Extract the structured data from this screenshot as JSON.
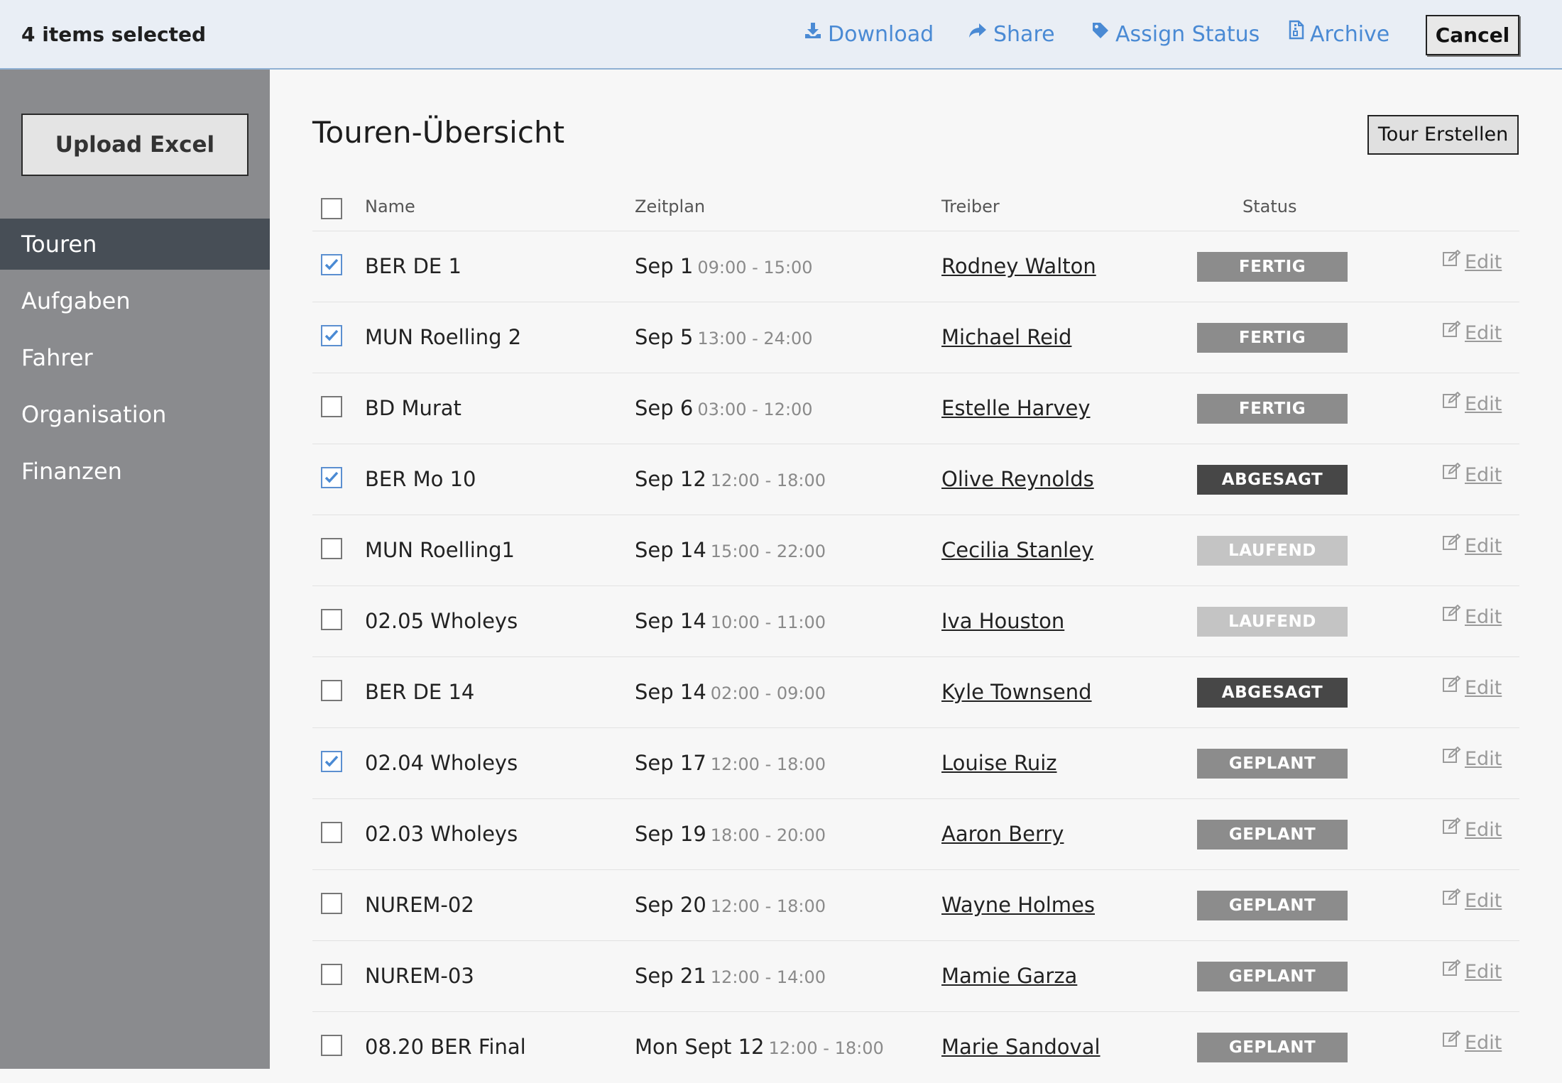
{
  "selection_bar": {
    "count_text": "4 items selected",
    "actions": [
      {
        "label": "Download",
        "icon": "download-icon"
      },
      {
        "label": "Share",
        "icon": "share-icon"
      },
      {
        "label": "Assign Status",
        "icon": "tag-icon"
      },
      {
        "label": "Archive",
        "icon": "archive-icon"
      }
    ],
    "cancel_label": "Cancel"
  },
  "sidebar": {
    "upload_label": "Upload Excel",
    "items": [
      {
        "label": "Touren",
        "active": true
      },
      {
        "label": "Aufgaben",
        "active": false
      },
      {
        "label": "Fahrer",
        "active": false
      },
      {
        "label": "Organisation",
        "active": false
      },
      {
        "label": "Finanzen",
        "active": false
      }
    ]
  },
  "main": {
    "title": "Touren-Übersicht",
    "create_label": "Tour Erstellen",
    "columns": {
      "name": "Name",
      "schedule": "Zeitplan",
      "driver": "Treiber",
      "status": "Status"
    },
    "edit_label": "Edit",
    "status_colors": {
      "FERTIG": "#8c8c8c",
      "ABGESAGT": "#474747",
      "LAUFEND": "#c4c4c4",
      "GEPLANT": "#8c8c8c"
    },
    "rows": [
      {
        "checked": true,
        "name": "BER DE 1",
        "date": "Sep 1",
        "time": "09:00 - 15:00",
        "driver": "Rodney Walton",
        "status": "FERTIG"
      },
      {
        "checked": true,
        "name": "MUN Roelling 2",
        "date": "Sep 5",
        "time": "13:00 - 24:00",
        "driver": "Michael Reid",
        "status": "FERTIG"
      },
      {
        "checked": false,
        "name": "BD Murat",
        "date": "Sep 6",
        "time": "03:00 - 12:00",
        "driver": "Estelle Harvey",
        "status": "FERTIG"
      },
      {
        "checked": true,
        "name": "BER Mo 10",
        "date": "Sep 12",
        "time": "12:00 - 18:00",
        "driver": "Olive Reynolds",
        "status": "ABGESAGT"
      },
      {
        "checked": false,
        "name": "MUN Roelling1",
        "date": "Sep 14",
        "time": "15:00 - 22:00",
        "driver": "Cecilia Stanley",
        "status": "LAUFEND"
      },
      {
        "checked": false,
        "name": "02.05 Wholeys",
        "date": "Sep 14",
        "time": "10:00 - 11:00",
        "driver": "Iva Houston",
        "status": "LAUFEND"
      },
      {
        "checked": false,
        "name": "BER DE 14",
        "date": "Sep 14",
        "time": "02:00 - 09:00",
        "driver": "Kyle Townsend",
        "status": "ABGESAGT"
      },
      {
        "checked": true,
        "name": "02.04 Wholeys",
        "date": "Sep 17",
        "time": "12:00 - 18:00",
        "driver": "Louise Ruiz",
        "status": "GEPLANT"
      },
      {
        "checked": false,
        "name": "02.03 Wholeys",
        "date": "Sep 19",
        "time": "18:00 - 20:00",
        "driver": "Aaron Berry",
        "status": "GEPLANT"
      },
      {
        "checked": false,
        "name": "NUREM-02",
        "date": "Sep 20",
        "time": "12:00 - 18:00",
        "driver": "Wayne Holmes",
        "status": "GEPLANT"
      },
      {
        "checked": false,
        "name": "NUREM-03",
        "date": "Sep 21",
        "time": "12:00 - 14:00",
        "driver": "Mamie Garza",
        "status": "GEPLANT"
      },
      {
        "checked": false,
        "name": "08.20 BER Final",
        "date": "Mon Sept 12",
        "time": "12:00 - 18:00",
        "driver": "Marie Sandoval",
        "status": "GEPLANT"
      }
    ]
  }
}
